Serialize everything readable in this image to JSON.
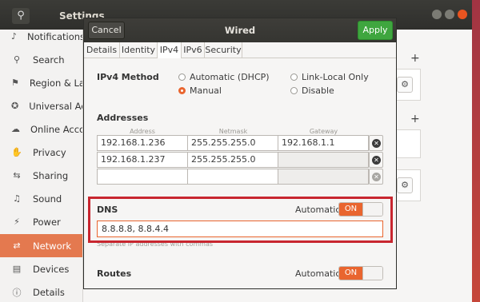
{
  "settings": {
    "title": "Settings",
    "search_icon": "search-icon",
    "sidebar": [
      {
        "label": "Notifications",
        "icon": "bell-icon",
        "glyph": "♪"
      },
      {
        "label": "Search",
        "icon": "search-icon",
        "glyph": "⚲"
      },
      {
        "label": "Region & Language",
        "icon": "flag-icon",
        "glyph": "⚑"
      },
      {
        "label": "Universal Access",
        "icon": "accessibility-icon",
        "glyph": "✪"
      },
      {
        "label": "Online Accounts",
        "icon": "cloud-icon",
        "glyph": "☁"
      },
      {
        "label": "Privacy",
        "icon": "hand-icon",
        "glyph": "✋"
      },
      {
        "label": "Sharing",
        "icon": "share-icon",
        "glyph": "⇆"
      },
      {
        "label": "Sound",
        "icon": "speaker-icon",
        "glyph": "♫"
      },
      {
        "label": "Power",
        "icon": "battery-icon",
        "glyph": "⚡"
      },
      {
        "label": "Network",
        "icon": "network-icon",
        "glyph": "⇄",
        "active": true
      },
      {
        "label": "Devices",
        "icon": "printer-icon",
        "glyph": "▤"
      },
      {
        "label": "Details",
        "icon": "info-icon",
        "glyph": "ⓘ"
      }
    ]
  },
  "dialog": {
    "title": "Wired",
    "cancel_label": "Cancel",
    "apply_label": "Apply",
    "tabs": [
      "Details",
      "Identity",
      "IPv4",
      "IPv6",
      "Security"
    ],
    "active_tab": "IPv4",
    "ipv4_method": {
      "label": "IPv4 Method",
      "options": [
        "Automatic (DHCP)",
        "Link-Local Only",
        "Manual",
        "Disable"
      ],
      "selected": "Manual"
    },
    "addresses": {
      "label": "Addresses",
      "columns": [
        "Address",
        "Netmask",
        "Gateway"
      ],
      "rows": [
        [
          "192.168.1.236",
          "255.255.255.0",
          "192.168.1.1"
        ],
        [
          "192.168.1.237",
          "255.255.255.0",
          ""
        ],
        [
          "",
          "",
          ""
        ]
      ]
    },
    "dns": {
      "label": "DNS",
      "automatic_label": "Automatic",
      "toggle": "ON",
      "value": "8.8.8.8, 8.8.4.4",
      "hint": "Separate IP addresses with commas"
    },
    "routes": {
      "label": "Routes",
      "automatic_label": "Automatic",
      "toggle": "ON"
    }
  },
  "colors": {
    "accent": "#e9652f",
    "apply_green": "#3fa63f",
    "highlight_red": "#c8262f"
  }
}
